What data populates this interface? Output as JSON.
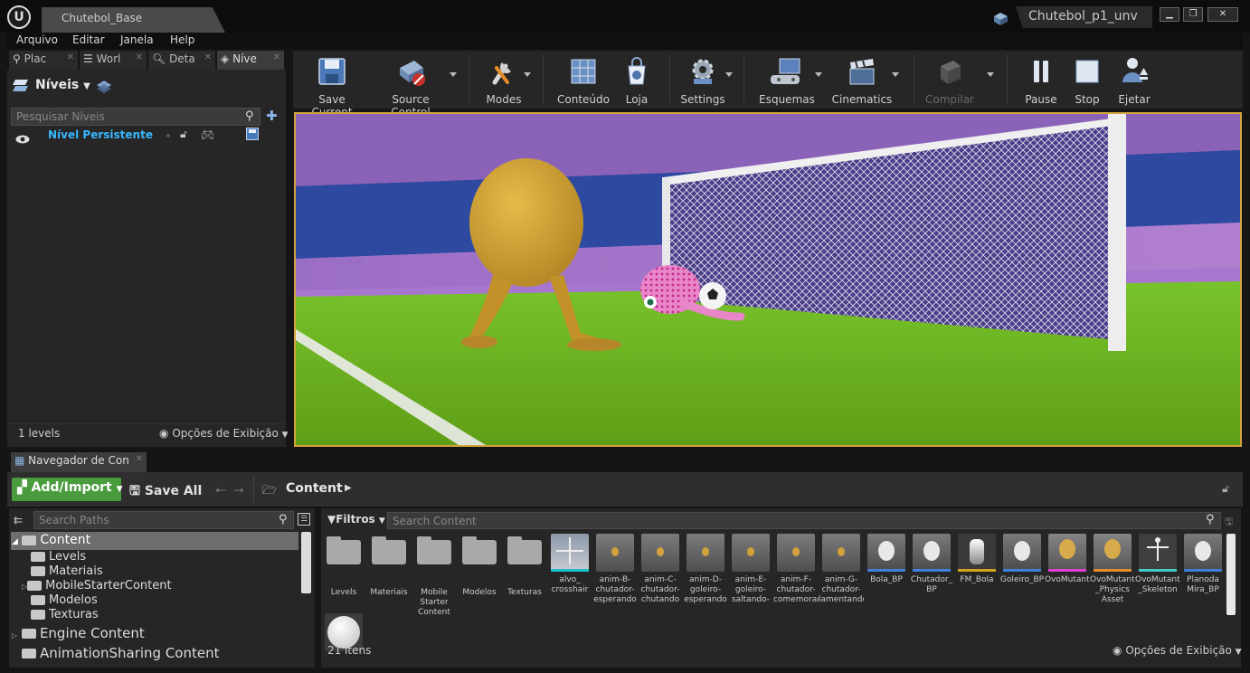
{
  "window": {
    "document_tab": "Chutebol_Base",
    "project_name": "Chutebol_p1_unv",
    "minimize": "▁",
    "maximize": "❐",
    "close": "✕"
  },
  "menu": [
    "Arquivo",
    "Editar",
    "Janela",
    "Help"
  ],
  "panel_tabs": [
    {
      "label": "Plac",
      "icon": "place-actors-icon"
    },
    {
      "label": "Worl",
      "icon": "world-outliner-icon"
    },
    {
      "label": "Deta",
      "icon": "details-icon"
    },
    {
      "label": "Níve",
      "icon": "levels-icon"
    }
  ],
  "levels_panel": {
    "title": "Níveis",
    "search_placeholder": "Pesquisar Níveis",
    "levels": [
      {
        "name": "Nível Persistente"
      }
    ],
    "count": "1 levels",
    "view_options": "Opções de Exibição"
  },
  "toolbar": [
    {
      "label": "Save Current",
      "icon": "save-icon"
    },
    {
      "label": "Source Control",
      "icon": "source-control-icon"
    },
    {
      "label": "Modes",
      "icon": "modes-icon"
    },
    {
      "label": "Conteúdo",
      "icon": "content-icon"
    },
    {
      "label": "Loja",
      "icon": "marketplace-icon"
    },
    {
      "label": "Settings",
      "icon": "settings-icon"
    },
    {
      "label": "Esquemas",
      "icon": "blueprints-icon"
    },
    {
      "label": "Cinematics",
      "icon": "cinematics-icon"
    },
    {
      "label": "Compilar",
      "icon": "build-icon",
      "disabled": true
    },
    {
      "label": "Pause",
      "icon": "pause-icon"
    },
    {
      "label": "Stop",
      "icon": "stop-icon"
    },
    {
      "label": "Ejetar",
      "icon": "eject-icon"
    }
  ],
  "content_browser": {
    "tab_label": "Navegador de Con",
    "add_import": "Add/Import",
    "save_all": "Save All",
    "path": "Content",
    "search_paths_placeholder": "Search Paths",
    "filters_label": "Filtros",
    "search_content_placeholder": "Search Content",
    "tree": [
      {
        "label": "Content",
        "level": 0,
        "selected": true
      },
      {
        "label": "Levels",
        "level": 1
      },
      {
        "label": "Materiais",
        "level": 1
      },
      {
        "label": "MobileStarterContent",
        "level": 1,
        "expandable": true
      },
      {
        "label": "Modelos",
        "level": 1
      },
      {
        "label": "Texturas",
        "level": 1
      },
      {
        "label": "Engine Content",
        "level": -1,
        "expandable": true
      },
      {
        "label": "AnimationSharing Content",
        "level": -1
      }
    ],
    "assets": [
      {
        "label": "Levels",
        "kind": "folder"
      },
      {
        "label": "Materiais",
        "kind": "folder"
      },
      {
        "label": "Mobile Starter Content",
        "kind": "folder"
      },
      {
        "label": "Modelos",
        "kind": "folder"
      },
      {
        "label": "Texturas",
        "kind": "folder"
      },
      {
        "label": "alvo_ crosshair",
        "kind": "texture",
        "bar": "#17c2c9"
      },
      {
        "label": "anim-B-chutador-esperando",
        "kind": "anim"
      },
      {
        "label": "anim-C-chutador-chutando",
        "kind": "anim"
      },
      {
        "label": "anim-D-goleiro-esperando",
        "kind": "anim"
      },
      {
        "label": "anim-E-goleiro-saltando-pra",
        "kind": "anim"
      },
      {
        "label": "anim-F-chutador-comemorando",
        "kind": "anim"
      },
      {
        "label": "anim-G-chutador-lamentando",
        "kind": "anim"
      },
      {
        "label": "Bola_BP",
        "kind": "blueprint",
        "bar": "#3f7fdd"
      },
      {
        "label": "Chutador_ BP",
        "kind": "blueprint",
        "bar": "#3f7fdd"
      },
      {
        "label": "FM_Bola",
        "kind": "mesh",
        "bar": "#d2a51a"
      },
      {
        "label": "Goleiro_BP",
        "kind": "blueprint",
        "bar": "#3f7fdd"
      },
      {
        "label": "OvoMutante",
        "kind": "skeletal",
        "bar": "#e23fd3"
      },
      {
        "label": "OvoMutante _Physics Asset",
        "kind": "physics",
        "bar": "#e48d2a"
      },
      {
        "label": "OvoMutante _Skeleton",
        "kind": "skeleton",
        "bar": "#43c9c9"
      },
      {
        "label": "Planoda Mira_BP",
        "kind": "blueprint",
        "bar": "#3f7fdd"
      },
      {
        "label": "",
        "kind": "sphere"
      }
    ],
    "item_count": "21 itens",
    "view_options": "Opções de Exibição"
  }
}
